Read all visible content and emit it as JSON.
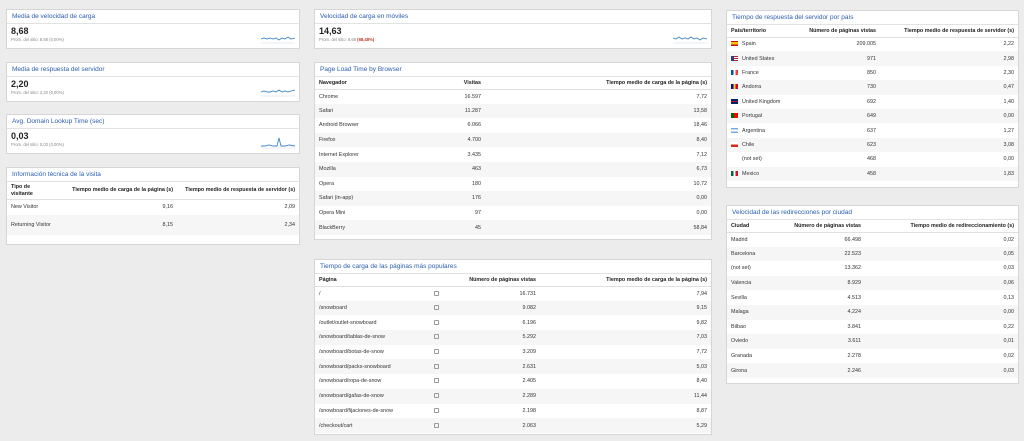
{
  "metrics": [
    {
      "title": "Media de velocidad de carga",
      "value": "8,68",
      "sub": "Prom. del sitio: 8,68 (0,00%)",
      "sub_neg": ""
    },
    {
      "title": "Velocidad de carga en móviles",
      "value": "14,63",
      "sub": "Prom. del sitio: 8,68 ",
      "sub_neg": "(68,48%)"
    },
    {
      "title": "Media de respuesta del servidor",
      "value": "2,20",
      "sub": "Prom. del sitio: 2,20 (0,00%)",
      "sub_neg": ""
    },
    {
      "title": "Avg. Domain Lookup Time (sec)",
      "value": "0,03",
      "sub": "Prom. del sitio: 0,03 (0,00%)",
      "sub_neg": ""
    }
  ],
  "tech": {
    "title": "Información técnica de la visita",
    "headers": [
      "Tipo de visitante",
      "Tiempo medio de carga de la página (s)",
      "Tiempo medio de respuesta de servidor (s)"
    ],
    "rows": [
      [
        "New Visitor",
        "9,16",
        "2,09"
      ],
      [
        "Returning Visitor",
        "8,15",
        "2,34"
      ]
    ]
  },
  "browser": {
    "title": "Page Load Time by Browser",
    "headers": [
      "Navegador",
      "Visitas",
      "Tiempo medio de carga de la página (s)"
    ],
    "rows": [
      [
        "Chrome",
        "16.597",
        "7,72"
      ],
      [
        "Safari",
        "11.287",
        "13,58"
      ],
      [
        "Android Browser",
        "6.066",
        "18,46"
      ],
      [
        "Firefox",
        "4.700",
        "8,40"
      ],
      [
        "Internet Explorer",
        "3.435",
        "7,12"
      ],
      [
        "Mozilla",
        "463",
        "6,73"
      ],
      [
        "Opera",
        "180",
        "10,72"
      ],
      [
        "Safari (in-app)",
        "176",
        "0,00"
      ],
      [
        "Opera Mini",
        "97",
        "0,00"
      ],
      [
        "BlackBerry",
        "45",
        "58,84"
      ]
    ]
  },
  "pages": {
    "title": "Tiempo de carga de las páginas más populares",
    "headers": [
      "Página",
      "Número de páginas vistas",
      "Tiempo medio de carga de la página (s)"
    ],
    "rows": [
      [
        "/",
        "16.731",
        "7,94"
      ],
      [
        "/snowboard",
        "9.082",
        "9,15"
      ],
      [
        "/outlet/outlet-snowboard",
        "6.196",
        "9,82"
      ],
      [
        "/snowboard/tablas-de-snow",
        "5.292",
        "7,03"
      ],
      [
        "/snowboard/botas-de-snow",
        "3.209",
        "7,72"
      ],
      [
        "/snowboard/packs-snowboard",
        "2.631",
        "5,03"
      ],
      [
        "/snowboard/ropa-de-snow",
        "2.405",
        "8,40"
      ],
      [
        "/snowboard/gafas-de-snow",
        "2.289",
        "11,44"
      ],
      [
        "/snowboard/fijaciones-de-snow",
        "2.198",
        "8,87"
      ],
      [
        "/checkout/cart",
        "2.063",
        "5,29"
      ]
    ]
  },
  "country": {
    "title": "Tiempo de respuesta del servidor por país",
    "headers": [
      "País/territorio",
      "Número de páginas vistas",
      "Tiempo medio de respuesta de servidor (s)"
    ],
    "rows": [
      {
        "name": "Spain",
        "views": "209.005",
        "time": "2,22",
        "flag": "es"
      },
      {
        "name": "United States",
        "views": "971",
        "time": "2,98",
        "flag": "us"
      },
      {
        "name": "France",
        "views": "850",
        "time": "2,30",
        "flag": "fr"
      },
      {
        "name": "Andorra",
        "views": "730",
        "time": "0,47",
        "flag": "ad"
      },
      {
        "name": "United Kingdom",
        "views": "692",
        "time": "1,40",
        "flag": "gb"
      },
      {
        "name": "Portugal",
        "views": "649",
        "time": "0,00",
        "flag": "pt"
      },
      {
        "name": "Argentina",
        "views": "637",
        "time": "1,27",
        "flag": "ar"
      },
      {
        "name": "Chile",
        "views": "623",
        "time": "3,08",
        "flag": "cl"
      },
      {
        "name": "(not set)",
        "views": "468",
        "time": "0,00",
        "flag": ""
      },
      {
        "name": "Mexico",
        "views": "458",
        "time": "1,83",
        "flag": "mx"
      }
    ]
  },
  "city": {
    "title": "Velocidad de las redirecciones por ciudad",
    "headers": [
      "Ciudad",
      "Número de páginas vistas",
      "Tiempo medio de redireccionamiento (s)"
    ],
    "rows": [
      [
        "Madrid",
        "66.498",
        "0,02"
      ],
      [
        "Barcelona",
        "22.523",
        "0,05"
      ],
      [
        "(not set)",
        "13.362",
        "0,03"
      ],
      [
        "Valencia",
        "8.929",
        "0,06"
      ],
      [
        "Sevilla",
        "4.513",
        "0,13"
      ],
      [
        "Malaga",
        "4.224",
        "0,00"
      ],
      [
        "Bilbao",
        "3.841",
        "0,22"
      ],
      [
        "Oviedo",
        "3.611",
        "0,01"
      ],
      [
        "Granada",
        "2.278",
        "0,02"
      ],
      [
        "Girona",
        "2.246",
        "0,03"
      ]
    ]
  },
  "colors": {
    "title": "#2a5db0",
    "spark": "#3d85c6",
    "negative": "#c0392b"
  }
}
